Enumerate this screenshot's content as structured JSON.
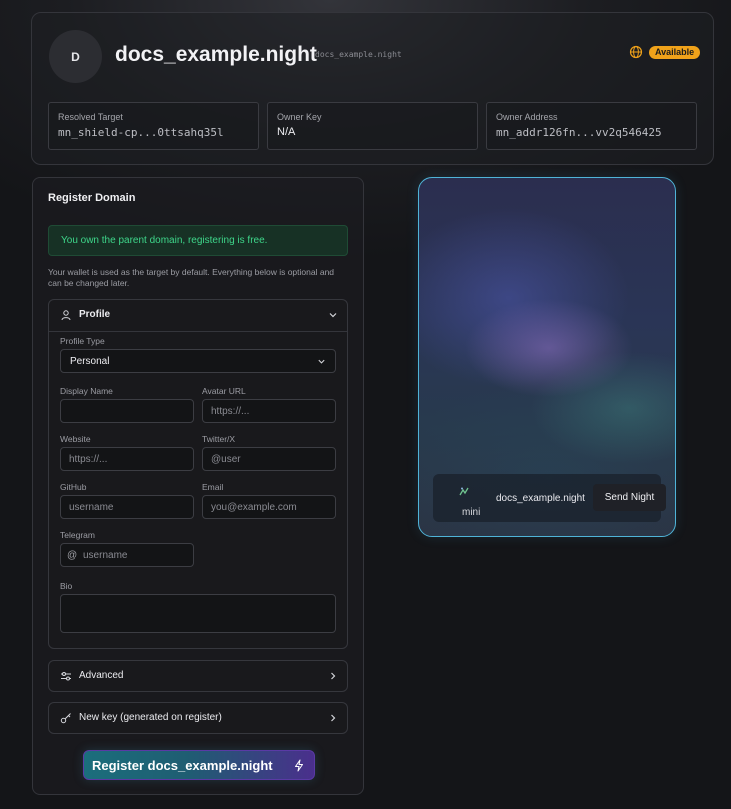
{
  "header": {
    "avatar_initial": "D",
    "domain": "docs_example.night",
    "domain_mono": "docs_example.night",
    "status_badge": "Available",
    "info": [
      {
        "label": "Resolved Target",
        "value": "mn_shield-cp...0ttsahq35l"
      },
      {
        "label": "Owner Key",
        "value": "N/A"
      },
      {
        "label": "Owner Address",
        "value": "mn_addr126fn...vv2q546425"
      }
    ]
  },
  "register": {
    "title": "Register Domain",
    "alert": "You own the parent domain, registering is free.",
    "helper": "Your wallet is used as the target by default. Everything below is optional and can be changed later.",
    "profile": {
      "label": "Profile",
      "profile_type_label": "Profile Type",
      "profile_type_value": "Personal",
      "display_name_label": "Display Name",
      "display_name_value": "",
      "avatar_url_label": "Avatar URL",
      "avatar_url_placeholder": "https://...",
      "website_label": "Website",
      "website_placeholder": "https://...",
      "twitter_label": "Twitter/X",
      "twitter_placeholder": "@user",
      "github_label": "GitHub",
      "github_placeholder": "username",
      "email_label": "Email",
      "email_placeholder": "you@example.com",
      "telegram_label": "Telegram",
      "telegram_prefix": "@",
      "telegram_placeholder": "username",
      "bio_label": "Bio",
      "bio_value": ""
    },
    "advanced_label": "Advanced",
    "new_key_label": "New key (generated on register)",
    "register_button": "Register docs_example.night"
  },
  "preview": {
    "logo_text": "mini",
    "domain": "docs_example.night",
    "send_button": "Send Night"
  },
  "colors": {
    "accent_badge": "#f0a21a",
    "success": "#3ed68a",
    "preview_border": "#4fb4d8"
  }
}
